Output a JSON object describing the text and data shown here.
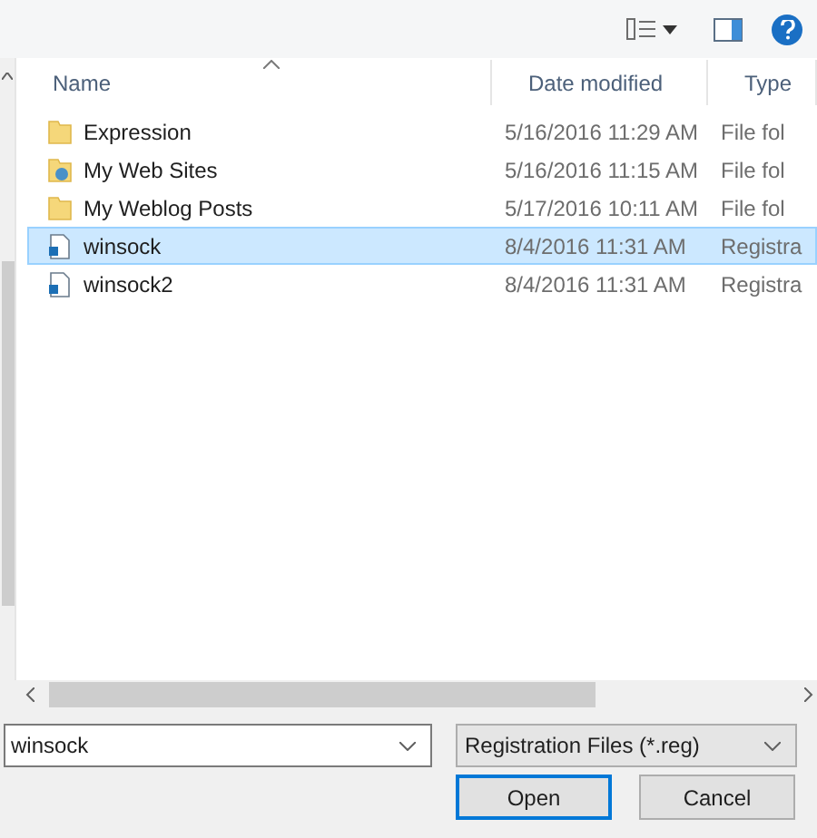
{
  "table": {
    "columns": [
      {
        "label": "Name",
        "sorted": true
      },
      {
        "label": "Date modified",
        "sorted": false
      },
      {
        "label": "Type",
        "sorted": false
      }
    ],
    "rows": [
      {
        "kind": "folder",
        "name": "Expression",
        "date": "5/16/2016 11:29 AM",
        "type": "File fol",
        "selected": false
      },
      {
        "kind": "web-folder",
        "name": "My Web Sites",
        "date": "5/16/2016 11:15 AM",
        "type": "File fol",
        "selected": false
      },
      {
        "kind": "folder",
        "name": "My Weblog Posts",
        "date": "5/17/2016 10:11 AM",
        "type": "File fol",
        "selected": false
      },
      {
        "kind": "reg-file",
        "name": "winsock",
        "date": "8/4/2016 11:31 AM",
        "type": "Registra",
        "selected": true
      },
      {
        "kind": "reg-file",
        "name": "winsock2",
        "date": "8/4/2016 11:31 AM",
        "type": "Registra",
        "selected": false
      }
    ]
  },
  "file_name": {
    "value": "winsock"
  },
  "file_type": {
    "value": "Registration Files (*.reg)"
  },
  "buttons": [
    {
      "label": "Open",
      "default": true
    },
    {
      "label": "Cancel",
      "default": false
    }
  ]
}
